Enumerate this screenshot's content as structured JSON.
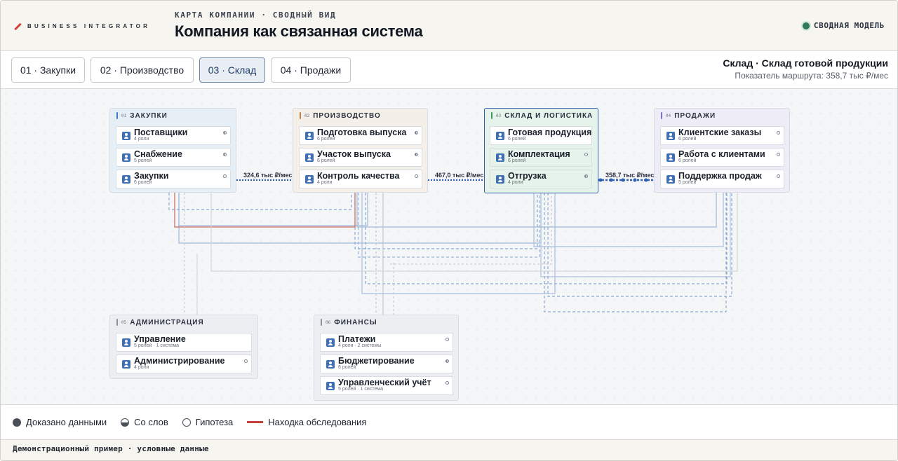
{
  "brand": {
    "logo_text": "BUSINESS INTEGRATOR"
  },
  "header": {
    "kicker": "КАРТА КОМПАНИИ · СВОДНЫЙ ВИД",
    "title": "Компания как связанная система",
    "model_status": "СВОДНАЯ МОДЕЛЬ",
    "model_status_color": "#2e7a58"
  },
  "tabs": [
    {
      "label": "01 · Закупки",
      "active": false
    },
    {
      "label": "02 · Производство",
      "active": false
    },
    {
      "label": "03 · Склад",
      "active": true
    },
    {
      "label": "04 · Продажи",
      "active": false
    }
  ],
  "route": {
    "title": "Склад · Склад готовой продукции",
    "metric": "Показатель маршрута: 358,7 тыс ₽/мес"
  },
  "groups": [
    {
      "num": "01",
      "name": "ЗАКУПКИ",
      "color": "#3f78c0",
      "nodes": [
        {
          "name": "Поставщики",
          "sub": "4 роли",
          "status": "half"
        },
        {
          "name": "Снабжение",
          "sub": "5 ролей",
          "status": "half"
        },
        {
          "name": "Закупки",
          "sub": "6 ролей",
          "status": "empty"
        }
      ]
    },
    {
      "num": "02",
      "name": "ПРОИЗВОДСТВО",
      "color": "#c27d4a",
      "nodes": [
        {
          "name": "Подготовка выпуска",
          "sub": "6 ролей",
          "status": "half"
        },
        {
          "name": "Участок выпуска",
          "sub": "6 ролей",
          "status": "half"
        },
        {
          "name": "Контроль качества",
          "sub": "4 роли",
          "status": "empty"
        }
      ]
    },
    {
      "num": "03",
      "name": "СКЛАД И ЛОГИСТИКА",
      "color": "#3f9a63",
      "nodes": [
        {
          "name": "Готовая продукция",
          "sub": "6 ролей",
          "status": "none"
        },
        {
          "name": "Комплектация",
          "sub": "6 ролей",
          "status": "empty"
        },
        {
          "name": "Отгрузка",
          "sub": "4 роли",
          "status": "half"
        }
      ]
    },
    {
      "num": "04",
      "name": "ПРОДАЖИ",
      "color": "#7c70bf",
      "nodes": [
        {
          "name": "Клиентские заказы",
          "sub": "6 ролей",
          "status": "empty"
        },
        {
          "name": "Работа с клиентами",
          "sub": "6 ролей",
          "status": "empty"
        },
        {
          "name": "Поддержка продаж",
          "sub": "5 ролей",
          "status": "empty"
        }
      ]
    },
    {
      "num": "05",
      "name": "АДМИНИСТРАЦИЯ",
      "color": "#8a8f99",
      "nodes": [
        {
          "name": "Управление",
          "sub": "5 ролей · 1 система",
          "status": "none"
        },
        {
          "name": "Администрирование",
          "sub": "4 роли",
          "status": "empty"
        }
      ]
    },
    {
      "num": "06",
      "name": "ФИНАНСЫ",
      "color": "#8a8f99",
      "nodes": [
        {
          "name": "Платежи",
          "sub": "4 роли · 2 системы",
          "status": "empty"
        },
        {
          "name": "Бюджетирование",
          "sub": "6 ролей",
          "status": "half"
        },
        {
          "name": "Управленческий учёт",
          "sub": "5 ролей · 1 система",
          "status": "empty"
        }
      ]
    }
  ],
  "flows": [
    {
      "label": "324,6 тыс ₽/мес"
    },
    {
      "label": "467,0 тыс ₽/мес"
    },
    {
      "label": "358,7 тыс ₽/мес"
    }
  ],
  "legend": {
    "proven": "Доказано данными",
    "verbal": "Со слов",
    "hypothesis": "Гипотеза",
    "finding": "Находка обследования",
    "finding_color": "#c4403b"
  },
  "footer": {
    "note": "Демонстрационный пример · условные данные"
  }
}
